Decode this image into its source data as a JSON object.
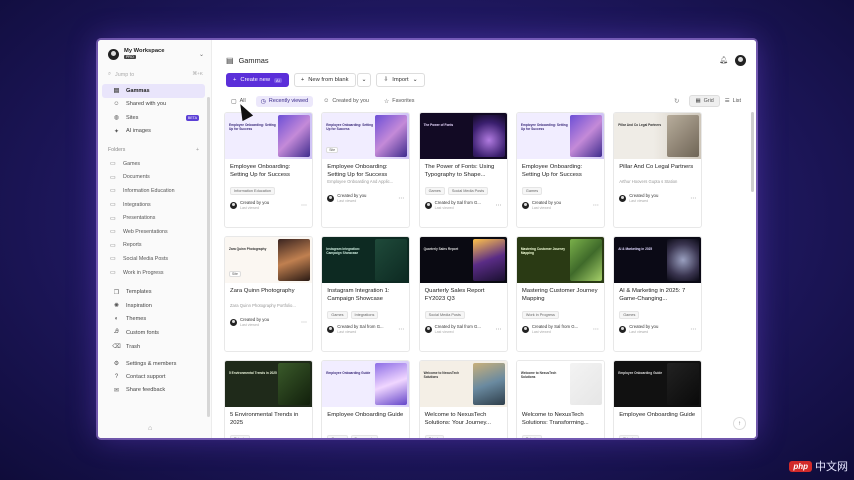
{
  "workspace": {
    "name": "My Workspace",
    "plan": "PRO"
  },
  "sidebar": {
    "search_placeholder": "Jump to",
    "search_shortcut": "⌘+K",
    "nav": [
      {
        "label": "Gammas",
        "icon": "gammas-icon"
      },
      {
        "label": "Shared with you",
        "icon": "users-icon"
      },
      {
        "label": "Sites",
        "icon": "globe-icon",
        "badge": "BETA"
      },
      {
        "label": "AI images",
        "icon": "sparkle-icon"
      }
    ],
    "folders_label": "Folders",
    "folders": [
      "Games",
      "Documents",
      "Information Education",
      "Integrations",
      "Presentations",
      "Web Presentations",
      "Reports",
      "Social Media Posts",
      "Work in Progress"
    ],
    "bottom_nav": [
      {
        "label": "Templates",
        "icon": "template-icon"
      },
      {
        "label": "Inspiration",
        "icon": "lightbulb-icon"
      },
      {
        "label": "Themes",
        "icon": "palette-icon"
      },
      {
        "label": "Custom fonts",
        "icon": "font-icon"
      },
      {
        "label": "Trash",
        "icon": "trash-icon"
      }
    ],
    "footer_nav": [
      {
        "label": "Settings & members",
        "icon": "gear-icon"
      },
      {
        "label": "Contact support",
        "icon": "help-icon"
      },
      {
        "label": "Share feedback",
        "icon": "chat-icon"
      }
    ]
  },
  "header": {
    "title": "Gammas"
  },
  "actions": {
    "create": "Create new",
    "create_badge": "AI",
    "blank": "New from blank",
    "import": "Import"
  },
  "filters": {
    "tabs": [
      "All",
      "Recently viewed",
      "Created by you",
      "Favorites"
    ],
    "active": 1,
    "grid_label": "Grid",
    "list_label": "List"
  },
  "cards": [
    {
      "title": "Employee Onboarding: Setting Up for Success",
      "thumb_text": "Employee Onboarding: Setting Up for Success",
      "theme": "lavender",
      "tags": [
        "Information Education"
      ],
      "creator": "Created by you",
      "when": "Last viewed"
    },
    {
      "title": "Employee Onboarding: Setting Up for Success",
      "subtitle": "Employee Onboarding And Applic...",
      "thumb_text": "Employee Onboarding: Setting Up for Success",
      "theme": "lavender",
      "tags": [],
      "badge": "Site",
      "creator": "Created by you",
      "when": "Last viewed"
    },
    {
      "title": "The Power of Fonts: Using Typography to Shape...",
      "thumb_text": "The Power of Fonts",
      "theme": "dark-purple",
      "tags": [
        "Games",
        "Social Media Posts"
      ],
      "creator": "Created by Sal from G...",
      "when": "Last viewed"
    },
    {
      "title": "Employee Onboarding: Setting Up for Success",
      "thumb_text": "Employee Onboarding: Setting Up for Success",
      "theme": "lavender",
      "tags": [
        "Games"
      ],
      "creator": "Created by you",
      "when": "Last viewed"
    },
    {
      "title": "Pillar And Co Legal Partners",
      "subtitle": "Arthur Hoovers Gupta s Station",
      "thumb_text": "Pillar And Co Legal Partners",
      "theme": "office",
      "tags": [],
      "creator": "Created by you",
      "when": "Last viewed"
    },
    {
      "title": "Zara Quinn Photography",
      "subtitle": "Zara Quinn Photography Portfolio...",
      "thumb_text": "Zara Quinn Photography",
      "theme": "portrait",
      "tags": [],
      "badge": "Site",
      "creator": "Created by you",
      "when": "Last viewed"
    },
    {
      "title": "Instagram Integration 1: Campaign Showcase",
      "thumb_text": "Instagram Integration: Campaign Showcase",
      "theme": "green-dark",
      "tags": [
        "Games",
        "Integrations"
      ],
      "creator": "Created by Sal from G...",
      "when": "Last viewed"
    },
    {
      "title": "Quarterly Sales Report FY2023 Q3",
      "thumb_text": "Quarterly Sales Report",
      "theme": "city",
      "tags": [
        "Social Media Posts"
      ],
      "creator": "Created by Sal from G...",
      "when": "Last viewed"
    },
    {
      "title": "Mastering Customer Journey Mapping",
      "thumb_text": "Mastering Customer Journey Mapping",
      "theme": "nature",
      "tags": [
        "Work in Progress"
      ],
      "creator": "Created by Sal from G...",
      "when": "Last viewed"
    },
    {
      "title": "AI & Marketing in 2025: 7 Game-Changing...",
      "thumb_text": "AI & Marketing in 2025",
      "theme": "tech",
      "tags": [
        "Games"
      ],
      "creator": "Created by you",
      "when": "Last viewed"
    },
    {
      "title": "5 Environmental Trends in 2025",
      "thumb_text": "5 Environmental Trends in 2025",
      "theme": "forest",
      "tags": [
        "Private"
      ],
      "creator": "",
      "when": ""
    },
    {
      "title": "Employee Onboarding Guide",
      "thumb_text": "Employee Onboarding Guide",
      "theme": "lavender2",
      "tags": [
        "Games",
        "Documents"
      ],
      "creator": "",
      "when": ""
    },
    {
      "title": "Welcome to NexusTech Solutions: Your Journey...",
      "thumb_text": "Welcome to NexusTech Solutions",
      "theme": "arch",
      "tags": [
        "Private"
      ],
      "creator": "",
      "when": ""
    },
    {
      "title": "Welcome to NexusTech Solutions: Transforming...",
      "thumb_text": "Welcome to NexusTech Solutions",
      "theme": "white",
      "tags": [
        "Private"
      ],
      "creator": "",
      "when": ""
    },
    {
      "title": "Employee Onboarding Guide",
      "thumb_text": "Employee Onboarding Guide",
      "theme": "black",
      "tags": [
        "Private"
      ],
      "creator": "",
      "when": ""
    }
  ],
  "watermark": {
    "brand": "php",
    "text": "中文网"
  }
}
